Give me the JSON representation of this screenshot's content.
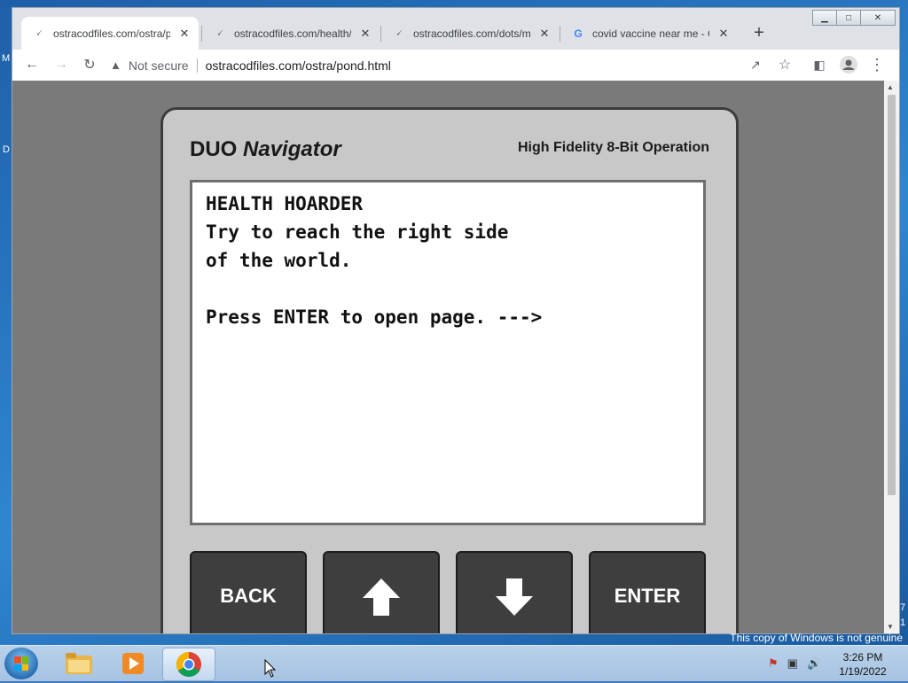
{
  "window": {
    "tabs": [
      {
        "title": "ostracodfiles.com/ostra/p",
        "active": true
      },
      {
        "title": "ostracodfiles.com/health/l",
        "active": false
      },
      {
        "title": "ostracodfiles.com/dots/m",
        "active": false
      },
      {
        "title": "covid vaccine near me - G",
        "active": false
      }
    ],
    "controls": {
      "minimize": "▁",
      "maximize": "□",
      "close": "✕"
    }
  },
  "toolbar": {
    "security_label": "Not secure",
    "url": "ostracodfiles.com/ostra/pond.html"
  },
  "page": {
    "brand_prefix": "DUO",
    "brand_name": "Navigator",
    "tagline": "High Fidelity 8-Bit Operation",
    "screen_lines": [
      "HEALTH HOARDER",
      "Try to reach the right side",
      "of the world.",
      "",
      "Press ENTER to open page. --->"
    ],
    "keys": {
      "back": "BACK",
      "up_icon": "arrow-up-icon",
      "down_icon": "arrow-down-icon",
      "enter": "ENTER"
    }
  },
  "desktop": {
    "genuine_notice": "This copy of Windows is not genuine",
    "edge_left_1": "M",
    "edge_left_2": "D",
    "edge_right_1": "7",
    "edge_right_2": "1"
  },
  "taskbar": {
    "time": "3:26 PM",
    "date": "1/19/2022"
  },
  "colors": {
    "device_body": "#c8c8c8",
    "page_background": "#7a7a7a",
    "key_background": "#3e3e3e"
  }
}
